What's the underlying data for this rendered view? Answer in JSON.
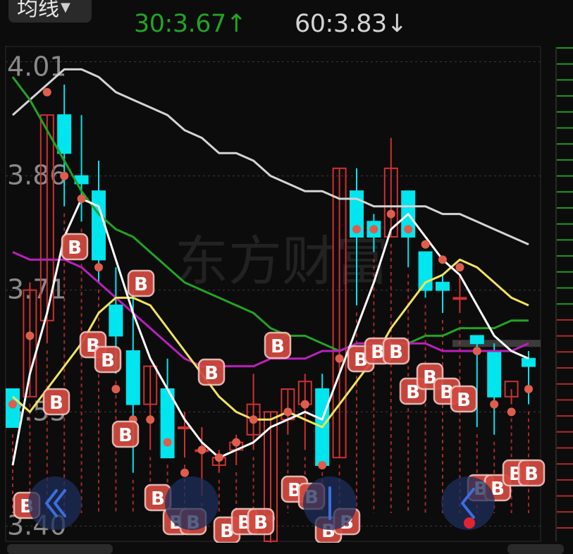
{
  "header": {
    "ma_selector_label": "均线",
    "ma30": {
      "text": "30:3.67",
      "arrow": "↑",
      "color": "#23a323"
    },
    "ma60": {
      "text": "60:3.83",
      "arrow": "↓",
      "color": "#d4d4d4"
    }
  },
  "watermark": "东方财富",
  "colors": {
    "up": "#d03030",
    "down": "#00e5ee",
    "ma5": "#ffffff",
    "ma10": "#f2e35a",
    "ma20": "#bb1fbb",
    "ma30": "#23a323",
    "ma60": "#d4d4d4",
    "marker": "#e05d4d"
  },
  "marker_label": "B",
  "chart_data": {
    "type": "candlestick",
    "yticks": [
      "4.01",
      "3.86",
      "3.71",
      "3.55",
      "3.40"
    ],
    "ylim": [
      3.38,
      4.03
    ],
    "candles": [
      {
        "o": 3.58,
        "h": 3.58,
        "l": 3.56,
        "c": 3.53
      },
      {
        "o": 3.57,
        "h": 3.72,
        "l": 3.57,
        "c": 3.71
      },
      {
        "o": 3.67,
        "h": 3.94,
        "l": 3.64,
        "c": 3.94
      },
      {
        "o": 3.94,
        "h": 3.98,
        "l": 3.82,
        "c": 3.89
      },
      {
        "o": 3.86,
        "h": 3.94,
        "l": 3.8,
        "c": 3.85
      },
      {
        "o": 3.84,
        "h": 3.88,
        "l": 3.72,
        "c": 3.75
      },
      {
        "o": 3.69,
        "h": 3.74,
        "l": 3.6,
        "c": 3.65
      },
      {
        "o": 3.63,
        "h": 3.71,
        "l": 3.47,
        "c": 3.56
      },
      {
        "o": 3.56,
        "h": 3.61,
        "l": 3.5,
        "c": 3.61
      },
      {
        "o": 3.58,
        "h": 3.62,
        "l": 3.51,
        "c": 3.49
      },
      {
        "o": 3.53,
        "h": 3.55,
        "l": 3.49,
        "c": 3.53
      },
      {
        "o": 3.5,
        "h": 3.53,
        "l": 3.44,
        "c": 3.5
      },
      {
        "o": 3.48,
        "h": 3.5,
        "l": 3.47,
        "c": 3.49
      },
      {
        "o": 3.5,
        "h": 3.52,
        "l": 3.48,
        "c": 3.51
      },
      {
        "o": 3.52,
        "h": 3.6,
        "l": 3.5,
        "c": 3.56
      },
      {
        "o": 3.38,
        "h": 3.55,
        "l": 3.37,
        "c": 3.55
      },
      {
        "o": 3.54,
        "h": 3.58,
        "l": 3.52,
        "c": 3.58
      },
      {
        "o": 3.56,
        "h": 3.6,
        "l": 3.5,
        "c": 3.59
      },
      {
        "o": 3.58,
        "h": 3.6,
        "l": 3.53,
        "c": 3.48
      },
      {
        "o": 3.49,
        "h": 3.87,
        "l": 3.49,
        "c": 3.87
      },
      {
        "o": 3.84,
        "h": 3.87,
        "l": 3.69,
        "c": 3.78
      },
      {
        "o": 3.8,
        "h": 3.81,
        "l": 3.76,
        "c": 3.78
      },
      {
        "o": 3.78,
        "h": 3.91,
        "l": 3.78,
        "c": 3.87
      },
      {
        "o": 3.84,
        "h": 3.83,
        "l": 3.74,
        "c": 3.78
      },
      {
        "o": 3.76,
        "h": 3.75,
        "l": 3.7,
        "c": 3.71
      },
      {
        "o": 3.72,
        "h": 3.73,
        "l": 3.68,
        "c": 3.71
      },
      {
        "o": 3.7,
        "h": 3.73,
        "l": 3.68,
        "c": 3.7
      },
      {
        "o": 3.65,
        "h": 3.65,
        "l": 3.53,
        "c": 3.64
      },
      {
        "o": 3.63,
        "h": 3.64,
        "l": 3.52,
        "c": 3.57
      },
      {
        "o": 3.57,
        "h": 3.58,
        "l": 3.56,
        "c": 3.59
      },
      {
        "o": 3.62,
        "h": 3.63,
        "l": 3.56,
        "c": 3.61
      }
    ],
    "ma_lines": {
      "ma5": [
        3.48,
        3.6,
        3.68,
        3.78,
        3.83,
        3.82,
        3.75,
        3.68,
        3.62,
        3.58,
        3.54,
        3.51,
        3.49,
        3.5,
        3.51,
        3.53,
        3.54,
        3.55,
        3.54,
        3.6,
        3.66,
        3.72,
        3.79,
        3.81,
        3.78,
        3.75,
        3.73,
        3.69,
        3.65,
        3.63,
        3.62
      ],
      "ma10": [
        3.57,
        3.55,
        3.58,
        3.61,
        3.64,
        3.68,
        3.7,
        3.7,
        3.69,
        3.66,
        3.63,
        3.6,
        3.57,
        3.55,
        3.54,
        3.54,
        3.55,
        3.54,
        3.53,
        3.56,
        3.59,
        3.62,
        3.66,
        3.69,
        3.72,
        3.73,
        3.75,
        3.74,
        3.72,
        3.7,
        3.69
      ],
      "ma20": [
        3.76,
        3.75,
        3.75,
        3.75,
        3.74,
        3.72,
        3.7,
        3.68,
        3.66,
        3.64,
        3.62,
        3.61,
        3.61,
        3.61,
        3.61,
        3.62,
        3.62,
        3.62,
        3.63,
        3.63,
        3.64,
        3.64,
        3.64,
        3.64,
        3.64,
        3.63,
        3.63,
        3.63,
        3.63,
        3.63,
        3.64
      ],
      "ma30": [
        3.99,
        3.96,
        3.92,
        3.88,
        3.84,
        3.81,
        3.79,
        3.78,
        3.76,
        3.74,
        3.72,
        3.71,
        3.7,
        3.69,
        3.68,
        3.66,
        3.65,
        3.65,
        3.64,
        3.63,
        3.64,
        3.64,
        3.64,
        3.64,
        3.65,
        3.65,
        3.66,
        3.66,
        3.66,
        3.67,
        3.67
      ],
      "ma60": [
        3.94,
        3.96,
        3.98,
        4.0,
        4.0,
        3.99,
        3.97,
        3.96,
        3.95,
        3.94,
        3.92,
        3.91,
        3.89,
        3.89,
        3.88,
        3.86,
        3.85,
        3.84,
        3.84,
        3.83,
        3.83,
        3.82,
        3.82,
        3.82,
        3.82,
        3.81,
        3.81,
        3.8,
        3.79,
        3.78,
        3.77
      ]
    },
    "dots": [
      3.56,
      3.65,
      3.97,
      3.86,
      3.83,
      3.74,
      3.58,
      3.54,
      3.54,
      3.51,
      3.47,
      3.5,
      3.49,
      3.51,
      3.54,
      3.41,
      3.55,
      3.56,
      3.48,
      3.62,
      3.79,
      3.79,
      3.81,
      3.79,
      3.77,
      3.75,
      3.74,
      3.63,
      3.56,
      3.55,
      3.58
    ]
  }
}
